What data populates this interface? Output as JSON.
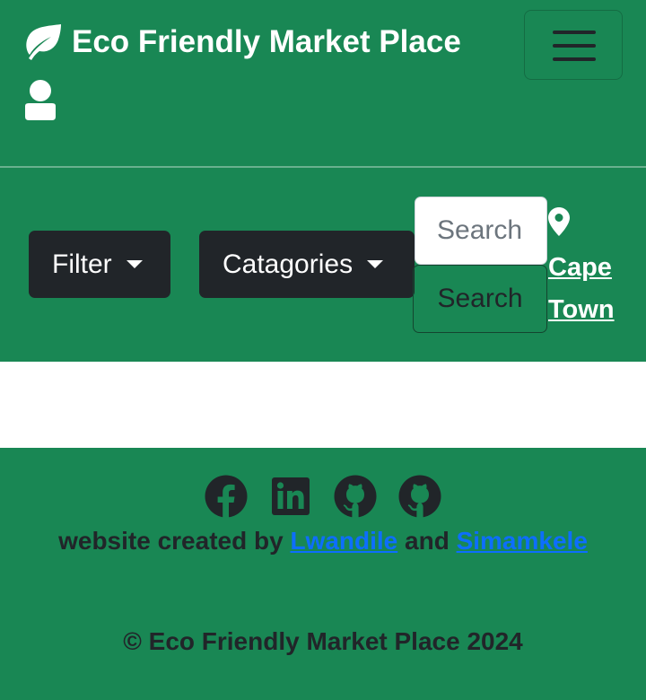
{
  "navbar": {
    "brand": "Eco Friendly Market Place",
    "icons": [
      "leaf-icon",
      "user-icon",
      "hamburger-menu-icon"
    ]
  },
  "toolbar": {
    "filter_label": "Filter",
    "categories_label": "Catagories",
    "search_placeholder": "Search",
    "search_button": "Search",
    "location_line1": "Cape",
    "location_line2": "Town",
    "location_icon": "map-pin-icon"
  },
  "footer": {
    "social_icons": [
      "facebook-icon",
      "linkedin-icon",
      "github-icon",
      "github-icon"
    ],
    "credit_prefix": "website created by",
    "credit_author1": "Lwandile",
    "credit_and": "and",
    "credit_author2": "Simamkele",
    "copyright": "© Eco Friendly Market Place 2024"
  },
  "colors": {
    "primary_green": "#198754",
    "dark": "#212529",
    "link_blue": "#0d6efd",
    "white": "#ffffff"
  }
}
